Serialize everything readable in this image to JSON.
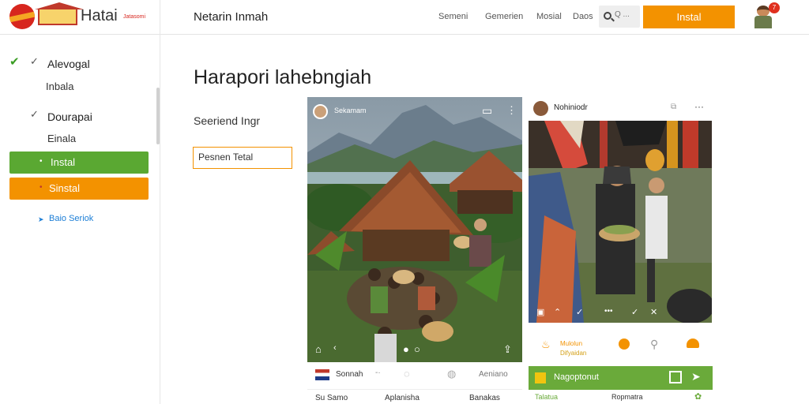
{
  "header": {
    "logo_name": "Hatai",
    "logo_sub": "Jatasomi",
    "site_title": "Netarin Inmah",
    "nav": [
      "Semeni",
      "Gemerien",
      "Mosial",
      "Daos"
    ],
    "search_placeholder": "Q ...",
    "install_label": "Instal",
    "notification_count": "7"
  },
  "sidebar": {
    "items": [
      {
        "label": "Alevogal",
        "sub": "Inbala"
      },
      {
        "label": "Dourapai",
        "sub": "Einala"
      }
    ],
    "btn_green": "Instal",
    "btn_orange": "Sinstal",
    "link": "Baio Seriok"
  },
  "main": {
    "heading": "Harapori lahebngiah",
    "subheading": "Seeriend Ingr",
    "field_value": "Pesnen Tetal"
  },
  "card1": {
    "author": "Sekamam",
    "footer_left": "Sonnah",
    "footer_right": "Aeniano",
    "row2_labels": [
      "Su Samo",
      "Aplanisha",
      "Banakas"
    ]
  },
  "card2": {
    "author": "Nohiniodr",
    "icon_labels": [
      "Mulolun",
      "Difyaidan"
    ],
    "green_label": "Nagoptonut",
    "row2_labels": [
      "Talatua",
      "Ropmatra"
    ]
  },
  "colors": {
    "accent_orange": "#f39200",
    "accent_green": "#6aaa3a",
    "brand_red": "#d7261e"
  }
}
